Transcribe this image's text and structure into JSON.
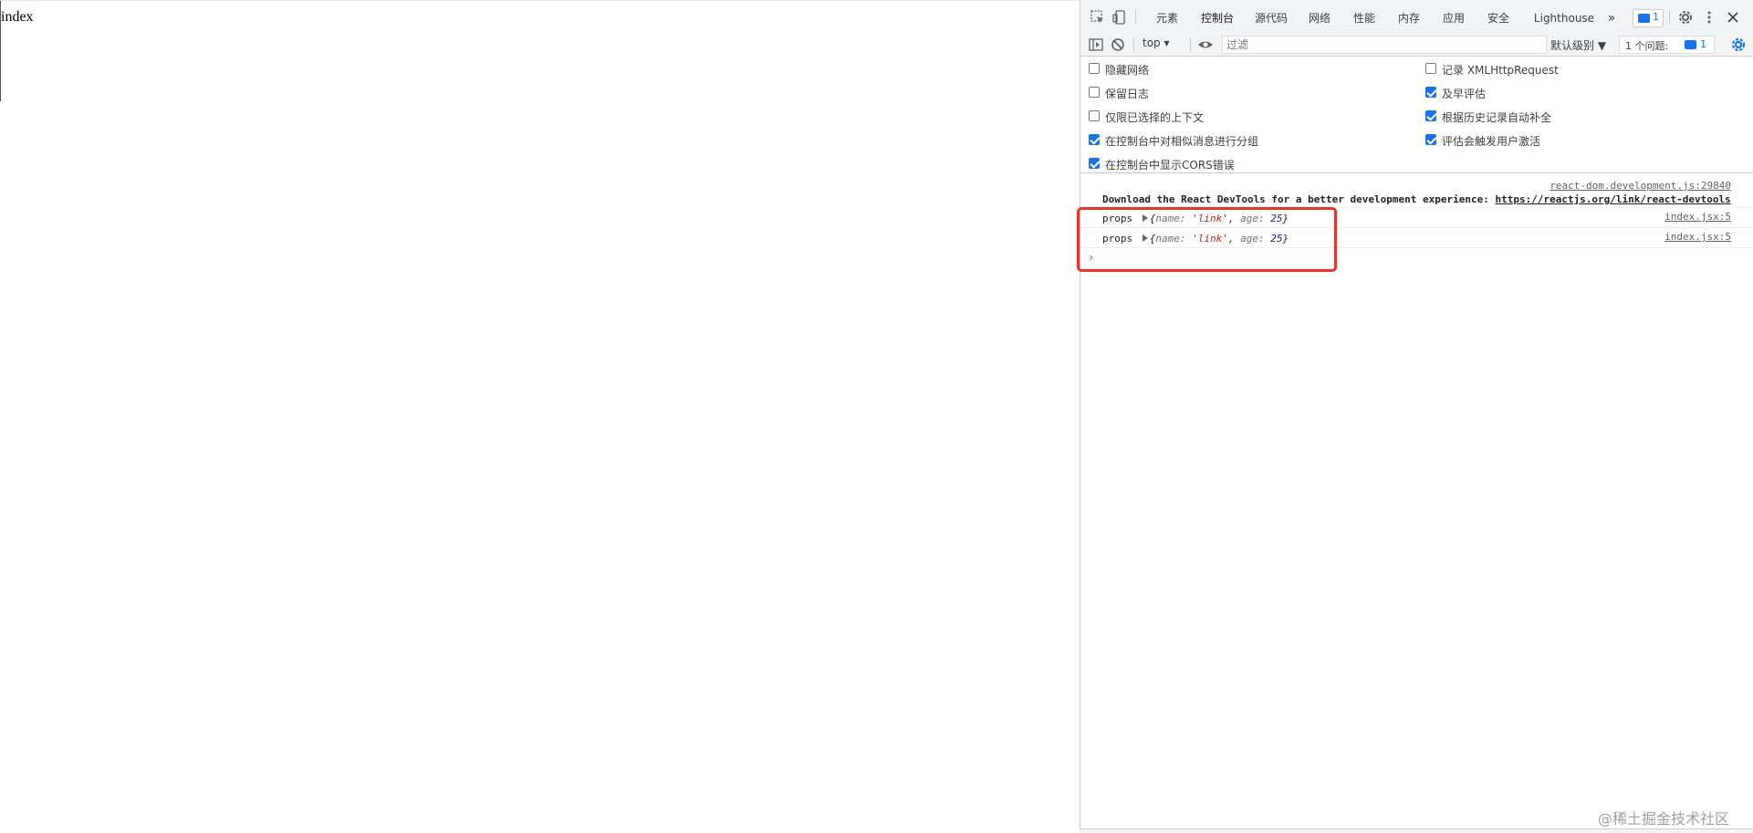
{
  "page": {
    "text": "index"
  },
  "devtools": {
    "tabs": [
      {
        "label": "元素"
      },
      {
        "label": "控制台"
      },
      {
        "label": "源代码"
      },
      {
        "label": "网络"
      },
      {
        "label": "性能"
      },
      {
        "label": "内存"
      },
      {
        "label": "应用"
      },
      {
        "label": "安全"
      },
      {
        "label": "Lighthouse"
      }
    ],
    "more_tabs": "»",
    "issues_badge": "1",
    "toolbar": {
      "context": "top",
      "filter_placeholder": "过滤",
      "levels": "默认级别 ▼",
      "issues_label": "1 个问题:",
      "issues_count": "1"
    },
    "settings": {
      "left": [
        {
          "label": "隐藏网络",
          "checked": false
        },
        {
          "label": "保留日志",
          "checked": false
        },
        {
          "label": "仅限已选择的上下文",
          "checked": false
        },
        {
          "label": "在控制台中对相似消息进行分组",
          "checked": true
        },
        {
          "label": "在控制台中显示CORS错误",
          "checked": true
        }
      ],
      "right": [
        {
          "label": "记录 XMLHttpRequest",
          "checked": false
        },
        {
          "label": "及早评估",
          "checked": true
        },
        {
          "label": "根据历史记录自动补全",
          "checked": true
        },
        {
          "label": "评估会触发用户激活",
          "checked": true
        }
      ]
    },
    "console": {
      "devtools_msg": {
        "source": "react-dom.development.js:29840",
        "text": "Download the React DevTools for a better development experience: ",
        "link": "https://reactjs.org/link/react-devtools"
      },
      "logs": [
        {
          "label": "props",
          "open": "{",
          "key1": "name:",
          "val1": "'link'",
          "sep": ",",
          "key2": "age:",
          "val2": "25",
          "close": "}",
          "source": "index.jsx:5"
        },
        {
          "label": "props",
          "open": "{",
          "key1": "name:",
          "val1": "'link'",
          "sep": ",",
          "key2": "age:",
          "val2": "25",
          "close": "}",
          "source": "index.jsx:5"
        }
      ],
      "prompt": "›"
    }
  },
  "watermark": "@稀土掘金技术社区",
  "colors": {
    "accent": "#1a73e8",
    "highlight": "#e8342b"
  }
}
